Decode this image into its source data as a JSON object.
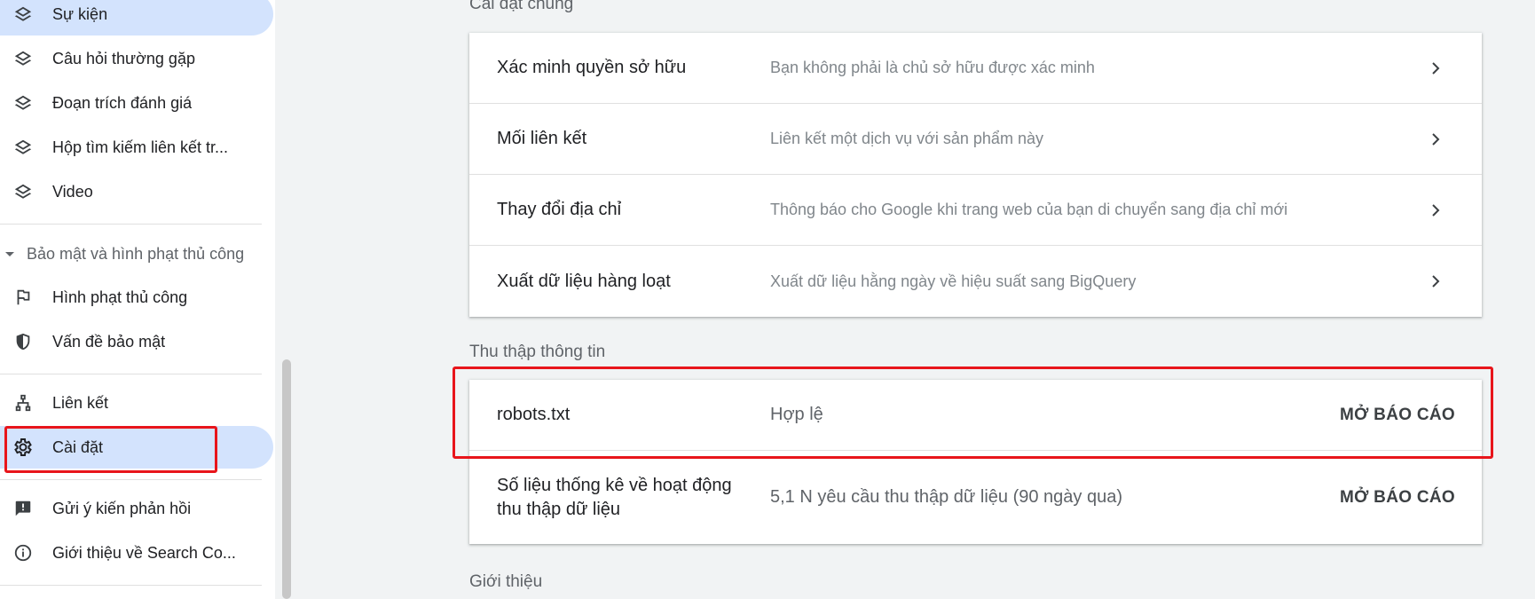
{
  "sidebar": {
    "items": [
      {
        "label": "Sự kiện",
        "icon": "layers-icon"
      },
      {
        "label": "Câu hỏi thường gặp",
        "icon": "layers-icon"
      },
      {
        "label": "Đoạn trích đánh giá",
        "icon": "layers-icon"
      },
      {
        "label": "Hộp tìm kiếm liên kết tr...",
        "icon": "layers-icon"
      },
      {
        "label": "Video",
        "icon": "layers-icon"
      }
    ],
    "security_section": {
      "header": "Bảo mật và hình phạt thủ công",
      "items": [
        {
          "label": "Hình phạt thủ công",
          "icon": "flag-icon"
        },
        {
          "label": "Vấn đề bảo mật",
          "icon": "shield-icon"
        }
      ]
    },
    "links_label": "Liên kết",
    "settings_label": "Cài đặt",
    "feedback_label": "Gửi ý kiến phản hồi",
    "about_label": "Giới thiệu về Search Co..."
  },
  "main": {
    "general_title": "Cài đặt chung",
    "general_rows": [
      {
        "title": "Xác minh quyền sở hữu",
        "desc": "Bạn không phải là chủ sở hữu được xác minh"
      },
      {
        "title": "Mối liên kết",
        "desc": "Liên kết một dịch vụ với sản phẩm này"
      },
      {
        "title": "Thay đổi địa chỉ",
        "desc": "Thông báo cho Google khi trang web của bạn di chuyển sang địa chỉ mới"
      },
      {
        "title": "Xuất dữ liệu hàng loạt",
        "desc": "Xuất dữ liệu hằng ngày về hiệu suất sang BigQuery"
      }
    ],
    "crawl_title": "Thu thập thông tin",
    "crawl_rows": [
      {
        "title": "robots.txt",
        "desc": "Hợp lệ",
        "action": "MỞ BÁO CÁO"
      },
      {
        "title": "Số liệu thống kê về hoạt động thu thập dữ liệu",
        "desc": "5,1 N yêu cầu thu thập dữ liệu (90 ngày qua)",
        "action": "MỞ BÁO CÁO"
      }
    ],
    "about_title": "Giới thiệu"
  },
  "colors": {
    "highlight": "#e8151b",
    "active_bg": "#d3e3fd"
  }
}
